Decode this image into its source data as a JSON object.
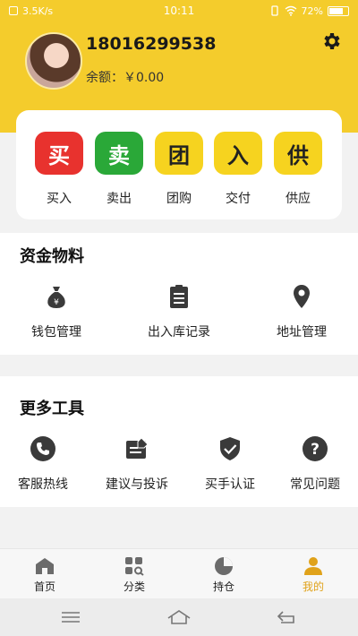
{
  "status": {
    "speed": "3.5K/s",
    "time": "10:11",
    "battery": "72%"
  },
  "profile": {
    "phone": "18016299538",
    "balance": "余额：￥0.00"
  },
  "actions": [
    {
      "glyph": "买",
      "label": "买入",
      "color": "#e8322e",
      "text_color": "#ffffff"
    },
    {
      "glyph": "卖",
      "label": "卖出",
      "color": "#2aa838",
      "text_color": "#ffffff"
    },
    {
      "glyph": "团",
      "label": "团购",
      "color": "#f6d31f",
      "text_color": "#222222"
    },
    {
      "glyph": "入",
      "label": "交付",
      "color": "#f6d31f",
      "text_color": "#222222"
    },
    {
      "glyph": "供",
      "label": "供应",
      "color": "#f6d31f",
      "text_color": "#222222"
    }
  ],
  "funds": {
    "title": "资金物料",
    "items": [
      {
        "icon": "money-bag-icon",
        "label": "钱包管理"
      },
      {
        "icon": "clipboard-icon",
        "label": "出入库记录"
      },
      {
        "icon": "location-pin-icon",
        "label": "地址管理"
      }
    ]
  },
  "tools": {
    "title": "更多工具",
    "items": [
      {
        "icon": "phone-icon",
        "label": "客服热线"
      },
      {
        "icon": "feedback-icon",
        "label": "建议与投诉"
      },
      {
        "icon": "shield-check-icon",
        "label": "买手认证"
      },
      {
        "icon": "question-icon",
        "label": "常见问题"
      }
    ]
  },
  "tabs": [
    {
      "icon": "home-icon",
      "label": "首页",
      "active": false
    },
    {
      "icon": "category-icon",
      "label": "分类",
      "active": false
    },
    {
      "icon": "holdings-icon",
      "label": "持仓",
      "active": false
    },
    {
      "icon": "user-icon",
      "label": "我的",
      "active": true
    }
  ],
  "colors": {
    "brand": "#f4cc2c",
    "active_tab": "#e0a21a",
    "icon": "#3a3a3a"
  }
}
